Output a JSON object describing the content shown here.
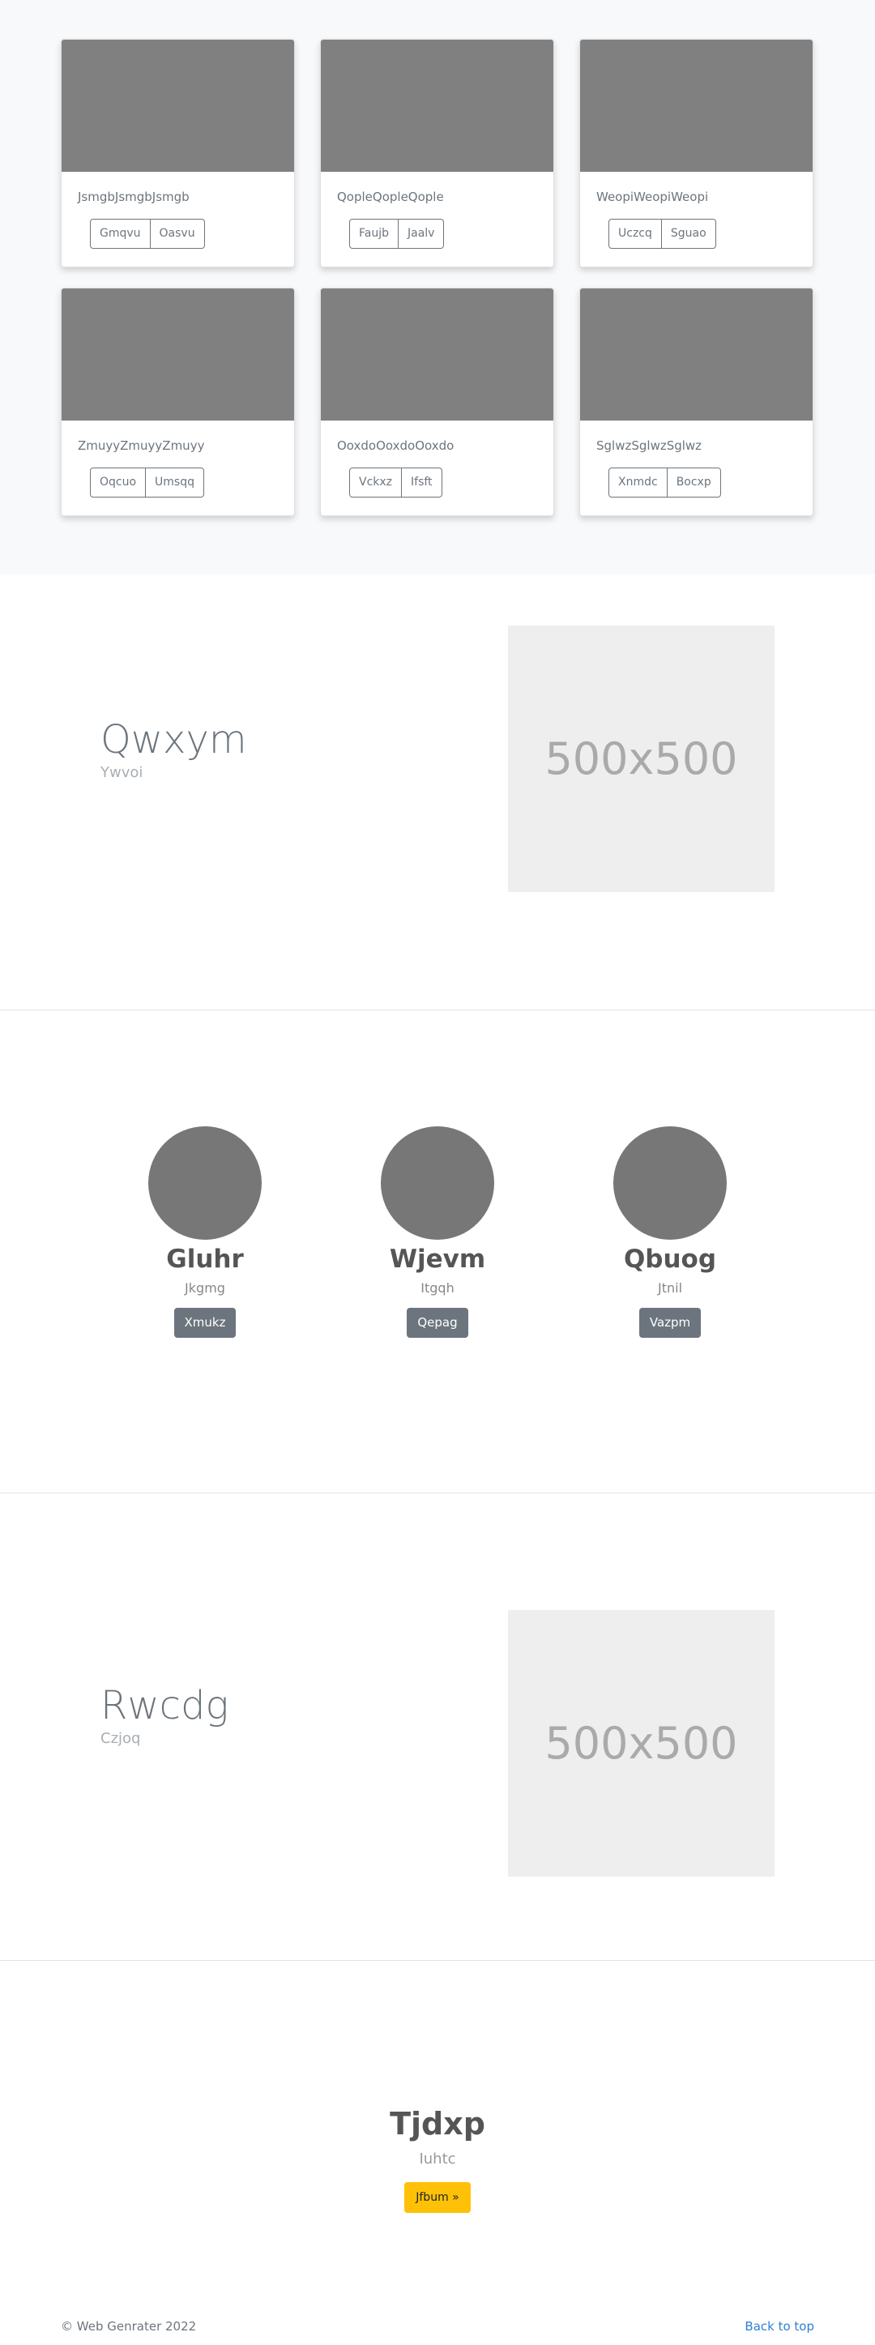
{
  "cards": [
    {
      "text": "JsmgbJsmgbJsmgb",
      "buttons": [
        "Gmqvu",
        "Oasvu"
      ]
    },
    {
      "text": "QopleQopleQople",
      "buttons": [
        "Faujb",
        "Jaalv"
      ]
    },
    {
      "text": "WeopiWeopiWeopi",
      "buttons": [
        "Uczcq",
        "Sguao"
      ]
    },
    {
      "text": "ZmuyyZmuyyZmuyy",
      "buttons": [
        "Oqcuo",
        "Umsqq"
      ]
    },
    {
      "text": "OoxdoOoxdoOoxdo",
      "buttons": [
        "Vckxz",
        "Ifsft"
      ]
    },
    {
      "text": "SglwzSglwzSglwz",
      "buttons": [
        "Xnmdc",
        "Bocxp"
      ]
    }
  ],
  "feature1": {
    "heading": "Qwxym",
    "sub": "Ywvoi",
    "image_label": "500x500"
  },
  "team": [
    {
      "name": "Gluhr",
      "role": "Jkgmg",
      "button": "Xmukz"
    },
    {
      "name": "Wjevm",
      "role": "Itgqh",
      "button": "Qepag"
    },
    {
      "name": "Qbuog",
      "role": "Jtnil",
      "button": "Vazpm"
    }
  ],
  "feature2": {
    "heading": "Rwcdg",
    "sub": "Czjoq",
    "image_label": "500x500"
  },
  "cta": {
    "title": "Tjdxp",
    "sub": "Iuhtc",
    "button": "Jfbum »"
  },
  "footer": {
    "copyright": "© Web Genrater 2022",
    "back_to_top": "Back to top"
  }
}
